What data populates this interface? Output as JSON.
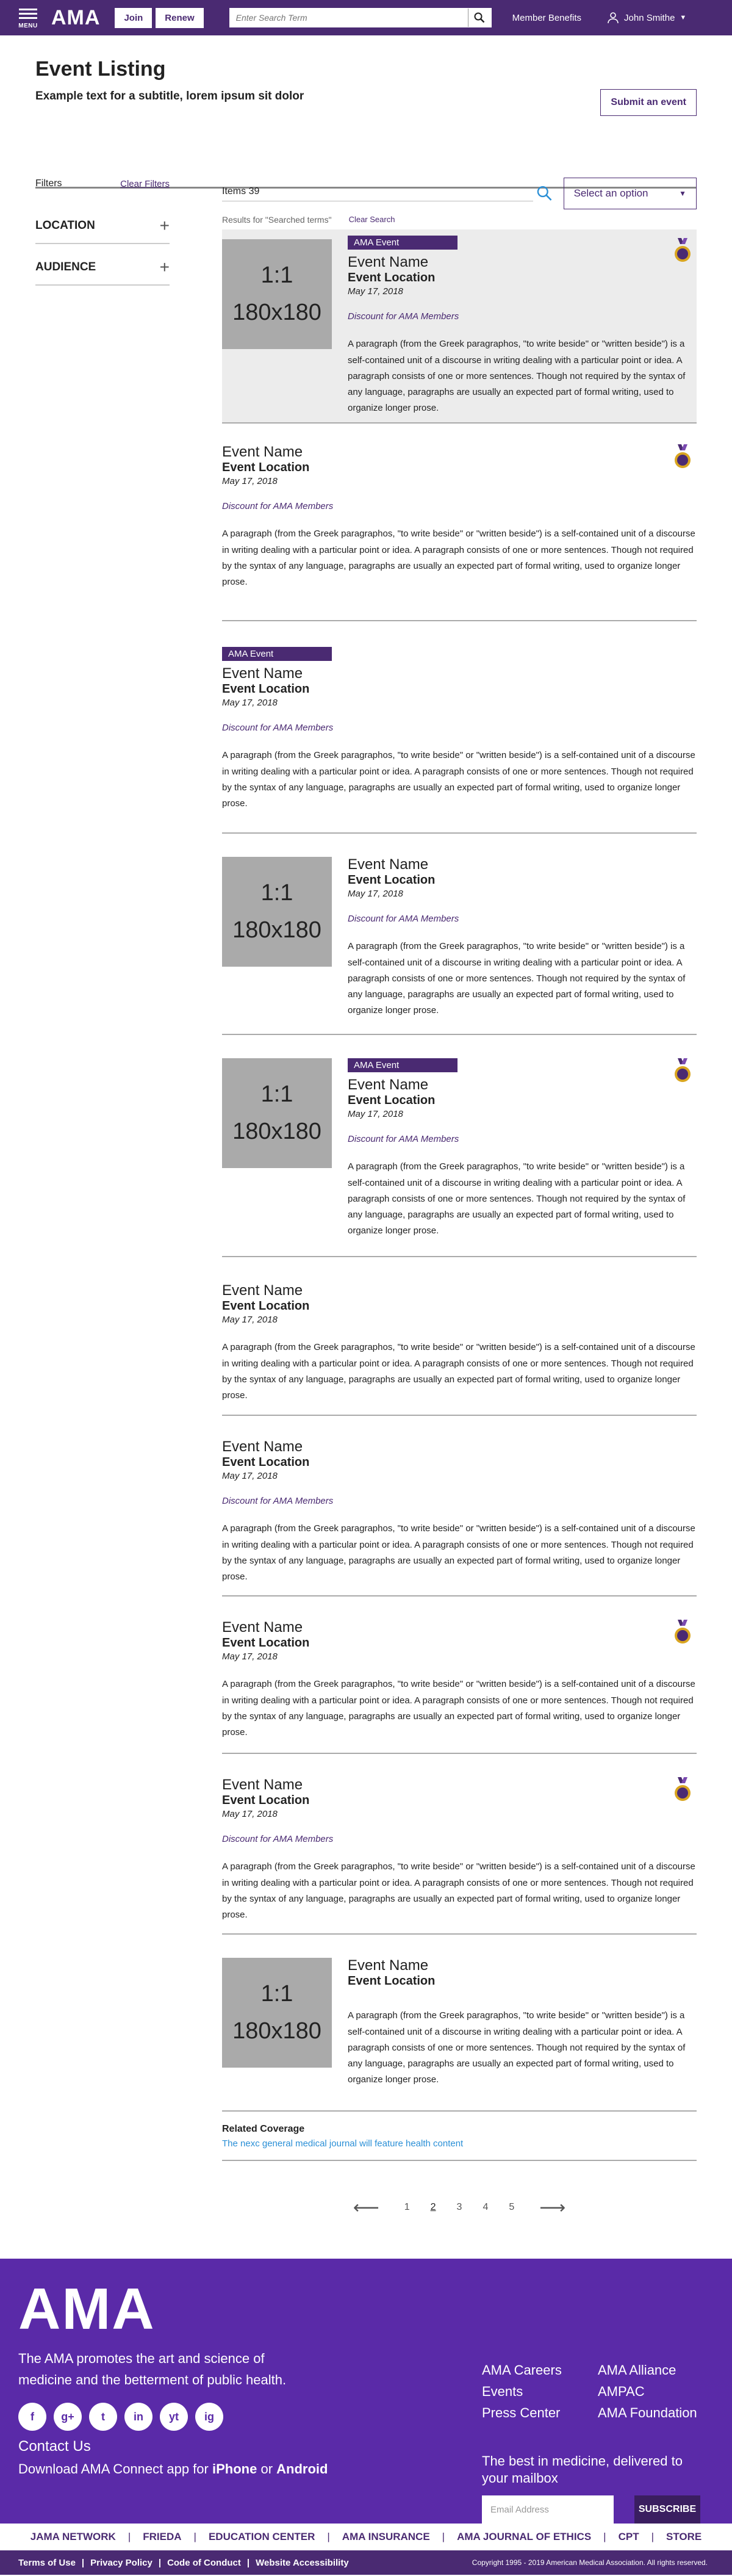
{
  "header": {
    "menu_label": "MENU",
    "logo": "AMA",
    "join": "Join",
    "renew": "Renew",
    "search_placeholder": "Enter Search Term",
    "member_benefits": "Member Benefits",
    "user_name": "John Smithe",
    "brand_color": "#4a2a72"
  },
  "page": {
    "title": "Event Listing",
    "subtitle": "Example text for a subtitle, lorem ipsum sit dolor",
    "submit": "Submit an event"
  },
  "filters": {
    "label": "Filters",
    "clear": "Clear Filters",
    "groups": [
      "LOCATION",
      "AUDIENCE"
    ]
  },
  "toolbar": {
    "items": "Items 39",
    "select": "Select an option",
    "results": "Results for \"Searched terms\"",
    "clear_search": "Clear Search"
  },
  "thumb": {
    "ratio": "1:1",
    "size": "180x180"
  },
  "events": [
    {
      "badge": "AMA Event",
      "name": "Event Name",
      "location": "Event Location",
      "date": "May 17, 2018",
      "discount": "Discount for AMA Members",
      "paragraph": "A paragraph (from the Greek paragraphos, \"to write beside\" or \"written beside\") is a self-contained unit of a discourse in writing dealing with a particular point or idea. A paragraph consists of one or more sentences. Though not required by the syntax of any language, paragraphs are usually an expected part of formal writing, used to organize longer prose."
    },
    {
      "name": "Event Name",
      "location": "Event Location",
      "date": "May 17, 2018",
      "discount": "Discount for AMA Members",
      "paragraph": "A paragraph (from the Greek paragraphos, \"to write beside\" or \"written beside\") is a self-contained unit of a discourse in writing dealing with a particular point or idea. A paragraph consists of one or more sentences. Though not required by the syntax of any language, paragraphs are usually an expected part of formal writing, used to organize longer prose."
    },
    {
      "badge": "AMA Event",
      "name": "Event Name",
      "location": "Event Location",
      "date": "May 17, 2018",
      "discount": "Discount for AMA Members",
      "paragraph": "A paragraph (from the Greek paragraphos, \"to write beside\" or \"written beside\") is a self-contained unit of a discourse in writing dealing with a particular point or idea. A paragraph consists of one or more sentences. Though not required by the syntax of any language, paragraphs are usually an expected part of formal writing, used to organize longer prose."
    },
    {
      "name": "Event Name",
      "location": "Event Location",
      "date": "May 17, 2018",
      "discount": "Discount for AMA Members",
      "paragraph": "A paragraph (from the Greek paragraphos, \"to write beside\" or \"written beside\") is a self-contained unit of a discourse in writing dealing with a particular point or idea. A paragraph consists of one or more sentences. Though not required by the syntax of any language, paragraphs are usually an expected part of formal writing, used to organize longer prose."
    },
    {
      "badge": "AMA Event",
      "name": "Event Name",
      "location": "Event Location",
      "date": "May 17, 2018",
      "discount": "Discount for AMA Members",
      "paragraph": "A paragraph (from the Greek paragraphos, \"to write beside\" or \"written beside\") is a self-contained unit of a discourse in writing dealing with a particular point or idea. A paragraph consists of one or more sentences. Though not required by the syntax of any language, paragraphs are usually an expected part of formal writing, used to organize longer prose."
    },
    {
      "name": "Event Name",
      "location": "Event Location",
      "date": "May 17, 2018",
      "paragraph": "A paragraph (from the Greek paragraphos, \"to write beside\" or \"written beside\") is a self-contained unit of a discourse in writing dealing with a particular point or idea. A paragraph consists of one or more sentences. Though not required by the syntax of any language, paragraphs are usually an expected part of formal writing, used to organize longer prose."
    },
    {
      "name": "Event Name",
      "location": "Event Location",
      "date": "May 17, 2018",
      "discount": "Discount for AMA Members",
      "paragraph": "A paragraph (from the Greek paragraphos, \"to write beside\" or \"written beside\") is a self-contained unit of a discourse in writing dealing with a particular point or idea. A paragraph consists of one or more sentences. Though not required by the syntax of any language, paragraphs are usually an expected part of formal writing, used to organize longer prose."
    },
    {
      "name": "Event Name",
      "location": "Event Location",
      "date": "May 17, 2018",
      "paragraph": "A paragraph (from the Greek paragraphos, \"to write beside\" or \"written beside\") is a self-contained unit of a discourse in writing dealing with a particular point or idea. A paragraph consists of one or more sentences. Though not required by the syntax of any language, paragraphs are usually an expected part of formal writing, used to organize longer prose."
    },
    {
      "name": "Event Name",
      "location": "Event Location",
      "date": "May 17, 2018",
      "discount": "Discount for AMA Members",
      "paragraph": "A paragraph (from the Greek paragraphos, \"to write beside\" or \"written beside\") is a self-contained unit of a discourse in writing dealing with a particular point or idea. A paragraph consists of one or more sentences. Though not required by the syntax of any language, paragraphs are usually an expected part of formal writing, used to organize longer prose."
    },
    {
      "name": "Event Name",
      "location": "Event Location",
      "paragraph": "A paragraph (from the Greek paragraphos, \"to write beside\" or \"written beside\") is a self-contained unit of a discourse in writing dealing with a particular point or idea. A paragraph consists of one or more sentences. Though not required by the syntax of any language, paragraphs are usually an expected part of formal writing, used to organize longer prose."
    }
  ],
  "related": {
    "heading": "Related Coverage",
    "link": "The nexc general medical journal will feature health content"
  },
  "pager": {
    "pages": [
      "1",
      "2",
      "3",
      "4",
      "5"
    ],
    "current": "2"
  },
  "footer": {
    "logo": "AMA",
    "mission": "The AMA promotes the art and science of medicine and the betterment of public health.",
    "social": [
      "f",
      "g+",
      "t",
      "in",
      "yt",
      "ig"
    ],
    "contact": "Contact Us",
    "download_prefix": "Download AMA Connect app for",
    "download_iphone": "iPhone",
    "download_or": "or",
    "download_android": "Android",
    "links_col1": [
      "AMA Careers",
      "Events",
      "Press Center"
    ],
    "links_col2": [
      "AMA Alliance",
      "AMPAC",
      "AMA Foundation"
    ],
    "newsletter": "The best in medicine, delivered to your mailbox",
    "email_placeholder": "Email Address",
    "subscribe": "SUBSCRIBE",
    "nav": [
      "JAMA NETWORK",
      "FRIEDA",
      "EDUCATION CENTER",
      "AMA INSURANCE",
      "AMA JOURNAL OF ETHICS",
      "CPT",
      "STORE"
    ],
    "legal": [
      "Terms of Use",
      "Privacy Policy",
      "Code of Conduct",
      "Website Accessibility"
    ],
    "copyright": "Copyright 1995 - 2019 American Medical Association. All rights reserved.",
    "footer_color": "#5a2aa8"
  }
}
